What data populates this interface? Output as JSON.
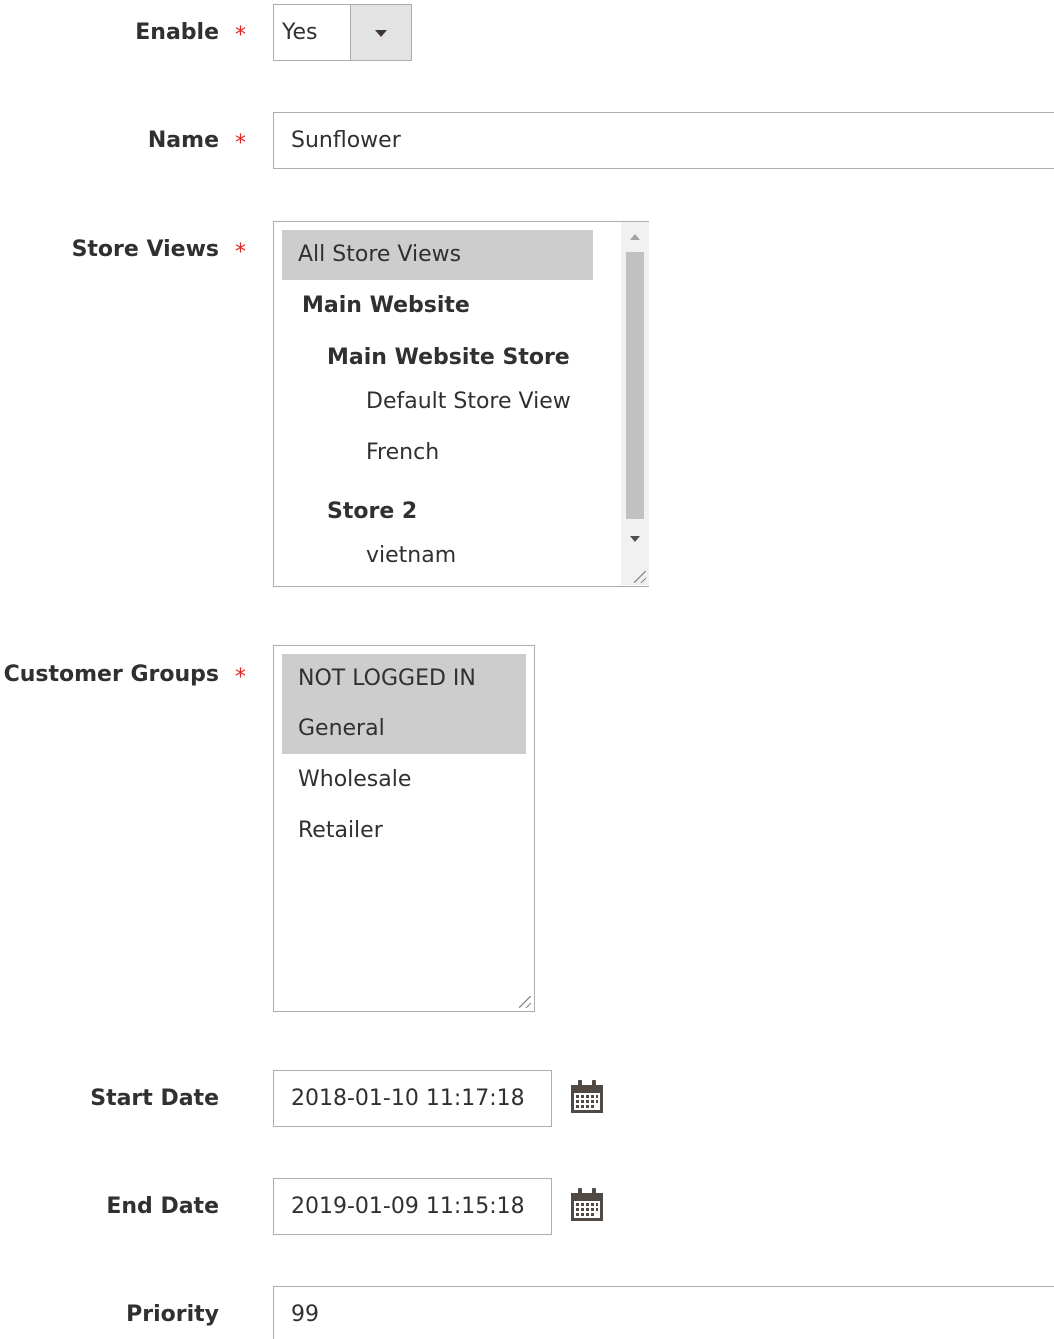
{
  "enable": {
    "label": "Enable",
    "required_mark": "*",
    "value": "Yes"
  },
  "name": {
    "label": "Name",
    "required_mark": "*",
    "value": "Sunflower"
  },
  "store_views": {
    "label": "Store Views",
    "required_mark": "*",
    "options": [
      {
        "text": "All Store Views",
        "selected": true,
        "kind": "option"
      },
      {
        "text": "Main Website",
        "selected": false,
        "kind": "group"
      },
      {
        "text": "Main Website Store",
        "selected": false,
        "kind": "group"
      },
      {
        "text": "Default Store View",
        "selected": false,
        "kind": "option"
      },
      {
        "text": "French",
        "selected": false,
        "kind": "option"
      },
      {
        "text": "Store 2",
        "selected": false,
        "kind": "group"
      },
      {
        "text": "vietnam",
        "selected": false,
        "kind": "option"
      }
    ]
  },
  "customer_groups": {
    "label": "Customer Groups",
    "required_mark": "*",
    "options": [
      {
        "text": "NOT LOGGED IN",
        "selected": true
      },
      {
        "text": "General",
        "selected": true
      },
      {
        "text": "Wholesale",
        "selected": false
      },
      {
        "text": "Retailer",
        "selected": false
      }
    ]
  },
  "start_date": {
    "label": "Start Date",
    "value": "2018-01-10 11:17:18",
    "icon": "calendar-icon"
  },
  "end_date": {
    "label": "End Date",
    "value": "2019-01-09 11:15:18",
    "icon": "calendar-icon"
  },
  "priority": {
    "label": "Priority",
    "value": "99"
  },
  "colors": {
    "required": "#e22626",
    "selected_option_bg": "#cdcdcd",
    "border": "#adadad"
  }
}
